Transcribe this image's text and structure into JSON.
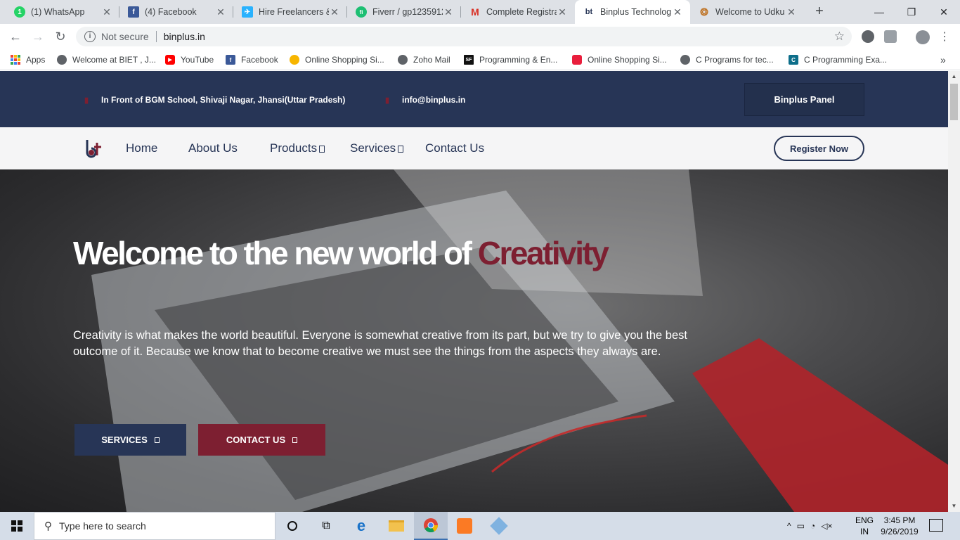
{
  "browser": {
    "tabs": [
      {
        "title": "(1) WhatsApp",
        "icon": "whatsapp-icon",
        "color": "#25d366",
        "glyph": "1"
      },
      {
        "title": "(4) Facebook",
        "icon": "facebook-icon",
        "color": "#3b5998",
        "glyph": "f"
      },
      {
        "title": "Hire Freelancers &",
        "icon": "freelancer-icon",
        "color": "#29b2fe",
        "glyph": "✈"
      },
      {
        "title": "Fiverr / gp1235912",
        "icon": "fiverr-icon",
        "color": "#1dbf73",
        "glyph": "fi"
      },
      {
        "title": "Complete Registra",
        "icon": "gmail-icon",
        "color": "#d93025",
        "glyph": "M"
      },
      {
        "title": "Binplus Technolog",
        "icon": "binplus-icon",
        "color": "#273556",
        "glyph": "bt"
      },
      {
        "title": "Welcome to Udku",
        "icon": "udku-icon",
        "color": "#c0772c",
        "glyph": "❂"
      }
    ],
    "new_tab": "+",
    "controls": {
      "minimize": "—",
      "maximize": "❐",
      "close": "✕"
    },
    "nav": {
      "back": "←",
      "forward": "→",
      "reload": "↻"
    },
    "omnibox": {
      "security": "Not secure",
      "url": "binplus.in",
      "info": "i",
      "star": "☆"
    },
    "bookmarks": [
      {
        "label": "Apps",
        "icon": "apps-grid-icon"
      },
      {
        "label": "Welcome at BIET , J...",
        "icon": "globe-icon",
        "color": "#5f6368"
      },
      {
        "label": "YouTube",
        "icon": "youtube-icon",
        "color": "#ff0000"
      },
      {
        "label": "Facebook",
        "icon": "facebook-icon",
        "color": "#3b5998"
      },
      {
        "label": "Online Shopping Si...",
        "icon": "flipkart-icon",
        "color": "#f7b500"
      },
      {
        "label": "Zoho Mail",
        "icon": "globe-icon",
        "color": "#5f6368"
      },
      {
        "label": "Programming & En...",
        "icon": "sf-icon",
        "color": "#111111"
      },
      {
        "label": "Online Shopping Si...",
        "icon": "shopping-icon",
        "color": "#e91e3c"
      },
      {
        "label": "C Programs for tec...",
        "icon": "globe-icon",
        "color": "#5f6368"
      },
      {
        "label": "C Programming Exa...",
        "icon": "c-prog-icon",
        "color": "#0d6e8a"
      }
    ],
    "bookmarks_more": "»"
  },
  "site": {
    "topbar": {
      "address": "In Front of BGM School, Shivaji Nagar, Jhansi(Uttar Pradesh)",
      "email": "info@binplus.in",
      "panel_button": "Binplus Panel"
    },
    "nav": {
      "logo_text": "bt",
      "items": [
        "Home",
        "About Us",
        "Products",
        "Services",
        "Contact Us"
      ],
      "register": "Register Now"
    },
    "hero": {
      "title_main": "Welcome to the new world of ",
      "title_accent": "Creativity",
      "text": "Creativity is what makes the world beautiful. Everyone is somewhat creative from its part, but we try to give you the best outcome of it. Because we know that to become creative we must see the things from the aspects they always are.",
      "btn_services": "SERVICES",
      "btn_contact": "CONTACT US"
    },
    "colors": {
      "navy": "#273556",
      "maroon": "#7d1f31"
    }
  },
  "taskbar": {
    "search_placeholder": "Type here to search",
    "lang_top": "ENG",
    "lang_bottom": "IN",
    "time": "3:45 PM",
    "date": "9/26/2019"
  }
}
